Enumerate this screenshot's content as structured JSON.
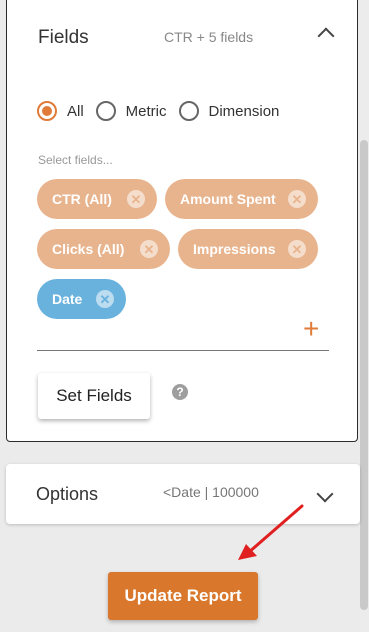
{
  "fields": {
    "title": "Fields",
    "summary": "CTR + 5 fields",
    "radios": [
      {
        "label": "All",
        "checked": true
      },
      {
        "label": "Metric",
        "checked": false
      },
      {
        "label": "Dimension",
        "checked": false
      }
    ],
    "select_label": "Select fields...",
    "chips": [
      {
        "label": "CTR (All)",
        "color": "#e8b48e"
      },
      {
        "label": "Amount Spent",
        "color": "#e8b48e"
      },
      {
        "label": "Clicks (All)",
        "color": "#e8b48e"
      },
      {
        "label": "Impressions",
        "color": "#e8b48e"
      },
      {
        "label": "Date",
        "color": "#6ab2de"
      }
    ],
    "add_icon": "plus-icon",
    "set_button_label": "Set Fields",
    "help_icon_glyph": "?"
  },
  "options": {
    "title": "Options",
    "summary": "<Date | 100000"
  },
  "update_button_label": "Update Report",
  "colors": {
    "accent": "#e07b39",
    "chip_orange": "#e8b48e",
    "chip_blue": "#6ab2de",
    "update_button": "#d9782c",
    "annotation_arrow": "#e02020"
  }
}
